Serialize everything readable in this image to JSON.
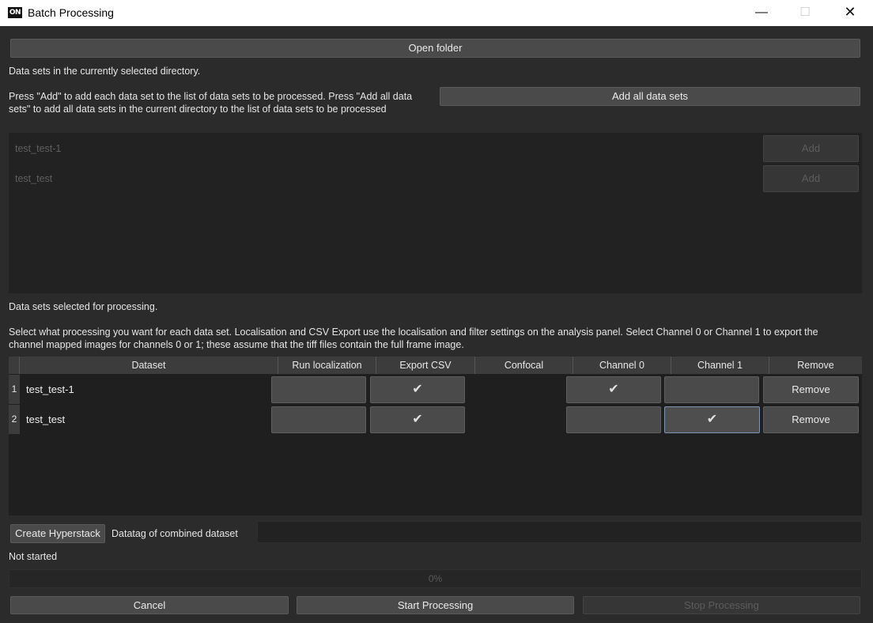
{
  "window": {
    "title": "Batch Processing",
    "logo_text": "ON",
    "minimize_glyph": "—",
    "maximize_glyph": "☐",
    "close_glyph": "✕"
  },
  "open_folder_label": "Open folder",
  "available": {
    "header": "Data sets in the currently selected directory.",
    "instructions": "Press \"Add\" to add each data set to the list of data sets to be processed. Press \"Add all data sets\" to add all data sets in the current directory to the list of data sets to be processed",
    "add_all_label": "Add all data sets",
    "items": [
      {
        "name": "test_test-1",
        "add_label": "Add"
      },
      {
        "name": "test_test",
        "add_label": "Add"
      }
    ]
  },
  "selected": {
    "header": "Data sets selected for processing.",
    "instructions": "Select what processing you want for each data set. Localisation and CSV Export use the localisation and filter settings on the analysis panel. Select Channel 0 or Channel 1 to export the channel mapped images for channels 0 or 1; these assume that the tiff files contain the full frame image.",
    "columns": [
      "Dataset",
      "Run localization",
      "Export CSV",
      "Confocal",
      "Channel 0",
      "Channel 1",
      "Remove"
    ],
    "rows": [
      {
        "num": "1",
        "dataset": "test_test-1",
        "run_localization": false,
        "export_csv": true,
        "channel0": true,
        "channel1": false,
        "remove_label": "Remove"
      },
      {
        "num": "2",
        "dataset": "test_test",
        "run_localization": false,
        "export_csv": true,
        "channel0": false,
        "channel1": true,
        "remove_label": "Remove"
      }
    ],
    "check_glyph": "✔"
  },
  "hyperstack": {
    "button_label": "Create Hyperstack",
    "datatag_label": "Datatag of combined dataset",
    "datatag_value": ""
  },
  "status": {
    "text": "Not started",
    "progress_text": "0%",
    "progress_percent": 0
  },
  "footer": {
    "cancel_label": "Cancel",
    "start_label": "Start Processing",
    "stop_label": "Stop Processing"
  }
}
